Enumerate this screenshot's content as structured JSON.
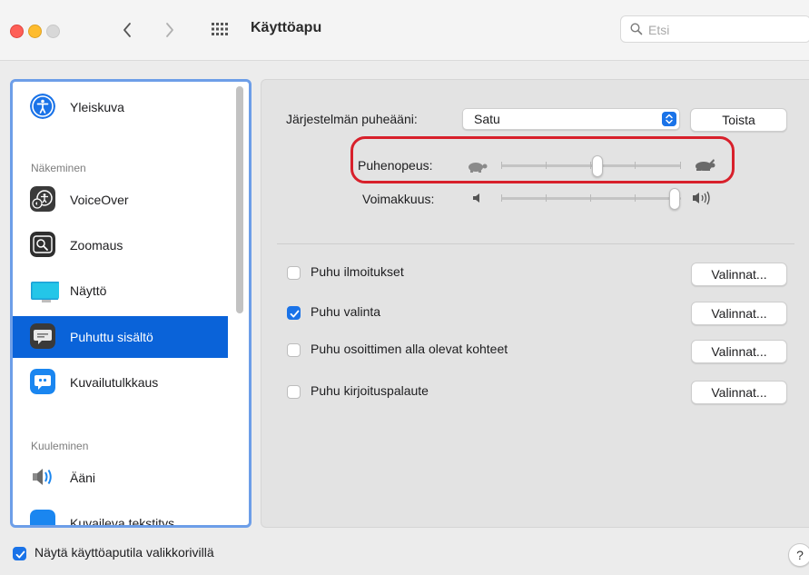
{
  "window": {
    "title": "Käyttöapu",
    "search_placeholder": "Etsi"
  },
  "sidebar": {
    "items": [
      {
        "label": "Yleiskuva",
        "icon": "accessibility-icon"
      },
      {
        "label": "VoiceOver",
        "icon": "voiceover-icon"
      },
      {
        "label": "Zoomaus",
        "icon": "zoom-icon"
      },
      {
        "label": "Näyttö",
        "icon": "display-icon"
      },
      {
        "label": "Puhuttu sisältö",
        "icon": "spoken-content-icon",
        "selected": true
      },
      {
        "label": "Kuvailutulkkaus",
        "icon": "description-icon"
      },
      {
        "label": "Ääni",
        "icon": "speaker-icon"
      },
      {
        "label": "Kuvaileva tekstitys",
        "icon": "captions-icon"
      }
    ],
    "sections": {
      "vision": "Näkeminen",
      "hearing": "Kuuleminen"
    }
  },
  "main": {
    "voice_label": "Järjestelmän puheääni:",
    "voice_value": "Satu",
    "play_button": "Toista",
    "rate_label": "Puhenopeus:",
    "rate_level": 0.5,
    "volume_label": "Voimakkuus:",
    "volume_level": 1.0,
    "options": [
      {
        "label": "Puhu ilmoitukset",
        "checked": false,
        "button": "Valinnat..."
      },
      {
        "label": "Puhu valinta",
        "checked": true,
        "button": "Valinnat..."
      },
      {
        "label": "Puhu osoittimen alla olevat kohteet",
        "checked": false,
        "button": "Valinnat..."
      },
      {
        "label": "Puhu kirjoituspalaute",
        "checked": false,
        "button": "Valinnat..."
      }
    ]
  },
  "footer": {
    "menu_checkbox_label": "Näytä käyttöaputila valikkorivillä",
    "menu_checkbox_checked": true,
    "help_label": "?"
  },
  "colors": {
    "accent": "#1a73e8",
    "selection": "#0a63d9",
    "highlight_ring": "#d8202b",
    "sidebar_focus": "#6d9ee8"
  }
}
